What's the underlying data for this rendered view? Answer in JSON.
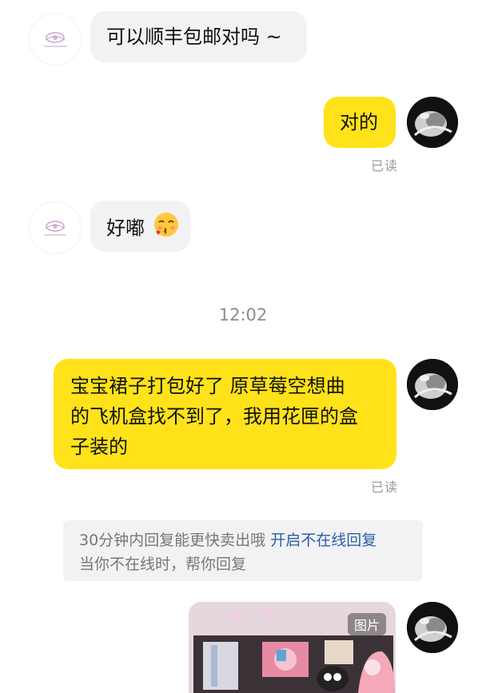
{
  "messages": [
    {
      "id": "m1",
      "from": "shop",
      "text": "可以顺丰包邮对吗 ~"
    },
    {
      "id": "m2",
      "from": "me",
      "text": "对的",
      "status": "已读"
    },
    {
      "id": "m3",
      "from": "shop",
      "text": "好嘟",
      "emoji": "kissing-face-emoji"
    },
    {
      "id": "m4",
      "from": "me",
      "lines": [
        "宝宝裙子打包好了 原草莓空想曲",
        "的飞机盒找不到了，我用花匣的盒",
        "子装的"
      ],
      "status": "已读"
    },
    {
      "id": "m5",
      "from": "me",
      "type": "image",
      "tag": "图片"
    }
  ],
  "timestamp": "12:02",
  "tip": {
    "text": "30分钟内回复能更快卖出哦",
    "link": "开启不在线回复",
    "subtext": "当你不在线时，帮你回复"
  },
  "colors": {
    "outgoing_bubble": "#ffe21a",
    "incoming_bubble": "#f2f2f4",
    "link": "#2a5ea8"
  },
  "icons": [
    "shop-avatar-logo",
    "user-avatar-photo",
    "kissing-face-emoji"
  ]
}
